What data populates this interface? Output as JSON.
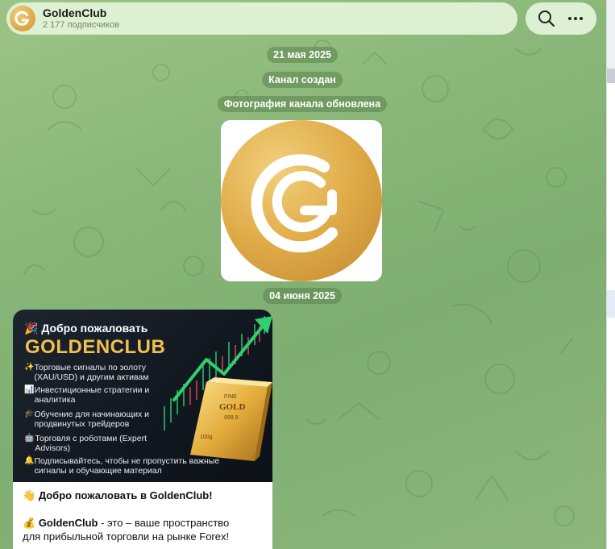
{
  "header": {
    "title": "GoldenClub",
    "subscribers": "2 177 подписчиков",
    "search_icon": "search-icon",
    "more_icon": "more-icon"
  },
  "service": {
    "date1": "21 мая 2025",
    "created": "Канал создан",
    "photo_updated": "Фотография канала обновлена",
    "date2": "04 июня 2025"
  },
  "post": {
    "banner": {
      "welcome": "🎉 Добро пожаловать",
      "brand": "GOLDENCLUB",
      "features": [
        {
          "icon": "✨",
          "text": "Торговые сигналы по золоту (XAU/USD) и другим активам"
        },
        {
          "icon": "📊",
          "text": "Инвестиционные стратегии и аналитика"
        },
        {
          "icon": "🎓",
          "text": "Обучение для начинающих и продвинутых трейдеров"
        },
        {
          "icon": "🤖",
          "text": "Торговля с роботами (Expert Advisors)"
        },
        {
          "icon": "🔔",
          "text": "Подписывайтесь, чтобы не пропустить важные сигналы и обучающие материал"
        }
      ],
      "bar_text_1": "FINE",
      "bar_text_2": "GOLD",
      "bar_text_3": "999.9",
      "bar_text_4": "100g"
    },
    "line1_emoji": "👋",
    "line1": "Добро пожаловать в GoldenClub!",
    "line2_emoji": "💰",
    "line2_bold": "GoldenClub",
    "line2_rest": " - это – ваше пространство",
    "line3": "для прибыльной торговли на рынке Forex!"
  },
  "colors": {
    "accent_gold": "#e0ad4a",
    "chat_green": "#88b678",
    "header_bg": "#e1f2d6"
  }
}
